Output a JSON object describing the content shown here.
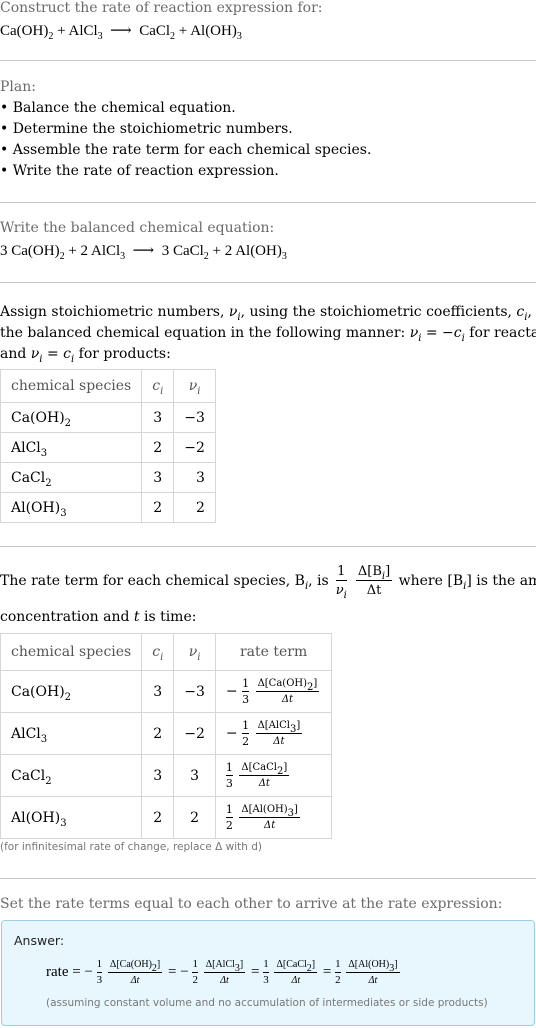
{
  "intro": {
    "heading": "Construct the rate of reaction expression for:",
    "reaction": {
      "r1": "Ca(OH)",
      "r1_sub": "2",
      "plus1": "+",
      "r2": "AlCl",
      "r2_sub": "3",
      "arrow": "⟶",
      "p1": "CaCl",
      "p1_sub": "2",
      "plus2": "+",
      "p2": "Al(OH)",
      "p2_sub": "3"
    }
  },
  "plan": {
    "heading": "Plan:",
    "items": [
      "• Balance the chemical equation.",
      "• Determine the stoichiometric numbers.",
      "• Assemble the rate term for each chemical species.",
      "• Write the rate of reaction expression."
    ]
  },
  "balanced": {
    "heading": "Write the balanced chemical equation:",
    "c1": "3",
    "r1": "Ca(OH)",
    "r1_sub": "2",
    "c2": "2",
    "r2": "AlCl",
    "r2_sub": "3",
    "c3": "3",
    "p1": "CaCl",
    "p1_sub": "2",
    "c4": "2",
    "p2": "Al(OH)",
    "p2_sub": "3",
    "plus": "+",
    "arrow": "⟶"
  },
  "stoich": {
    "text_line1_a": "Assign stoichiometric numbers, ",
    "nu_i": "ν",
    "i": "i",
    "text_line1_b": ", using the stoichiometric coefficients, ",
    "c_i": "c",
    "text_line1_c": ", from",
    "text_line2_a": "the balanced chemical equation in the following manner: ",
    "text_line2_b": " = −",
    "text_line2_c": " for reactants",
    "text_line3_a": "and ",
    "text_line3_b": " = ",
    "text_line3_c": " for products:",
    "table": {
      "headers": [
        "chemical species",
        "c",
        "ν"
      ],
      "rows": [
        {
          "species": "Ca(OH)",
          "sub": "2",
          "c": "3",
          "nu": "−3"
        },
        {
          "species": "AlCl",
          "sub": "3",
          "c": "2",
          "nu": "−2"
        },
        {
          "species": "CaCl",
          "sub": "2",
          "c": "3",
          "nu": "3"
        },
        {
          "species": "Al(OH)",
          "sub": "3",
          "c": "2",
          "nu": "2"
        }
      ]
    }
  },
  "rate_terms": {
    "text_a": "The rate term for each chemical species, B",
    "text_b": ", is ",
    "frac_num": "1",
    "frac_den": "ν",
    "delta_num": "Δ[B",
    "delta_num_end": "]",
    "delta_den": "Δt",
    "text_c": " where [B",
    "text_d": "] is the amount",
    "line2_a": "concentration and ",
    "t": "t",
    "line2_b": " is time:",
    "table": {
      "headers": [
        "chemical species",
        "c",
        "ν",
        "rate term"
      ],
      "rows": [
        {
          "species": "Ca(OH)",
          "sub": "2",
          "c": "3",
          "nu": "−3",
          "sign": "−",
          "coef_num": "1",
          "coef_den": "3",
          "conc": "Δ[Ca(OH)",
          "conc_sub": "2",
          "dt": "Δt"
        },
        {
          "species": "AlCl",
          "sub": "3",
          "c": "2",
          "nu": "−2",
          "sign": "−",
          "coef_num": "1",
          "coef_den": "2",
          "conc": "Δ[AlCl",
          "conc_sub": "3",
          "dt": "Δt"
        },
        {
          "species": "CaCl",
          "sub": "2",
          "c": "3",
          "nu": "3",
          "sign": "",
          "coef_num": "1",
          "coef_den": "3",
          "conc": "Δ[CaCl",
          "conc_sub": "2",
          "dt": "Δt"
        },
        {
          "species": "Al(OH)",
          "sub": "3",
          "c": "2",
          "nu": "2",
          "sign": "",
          "coef_num": "1",
          "coef_den": "2",
          "conc": "Δ[Al(OH)",
          "conc_sub": "3",
          "dt": "Δt"
        }
      ]
    },
    "note": "(for infinitesimal rate of change, replace Δ with d)"
  },
  "final": {
    "heading": "Set the rate terms equal to each other to arrive at the rate expression:",
    "answer_label": "Answer:",
    "rate_word": "rate",
    "eq": "=",
    "note": "(assuming constant volume and no accumulation of intermediates or side products)"
  },
  "colors": {
    "answer_bg": "#e8f7fd",
    "answer_border": "#9ccfe2",
    "divider": "#c8c8c8"
  }
}
